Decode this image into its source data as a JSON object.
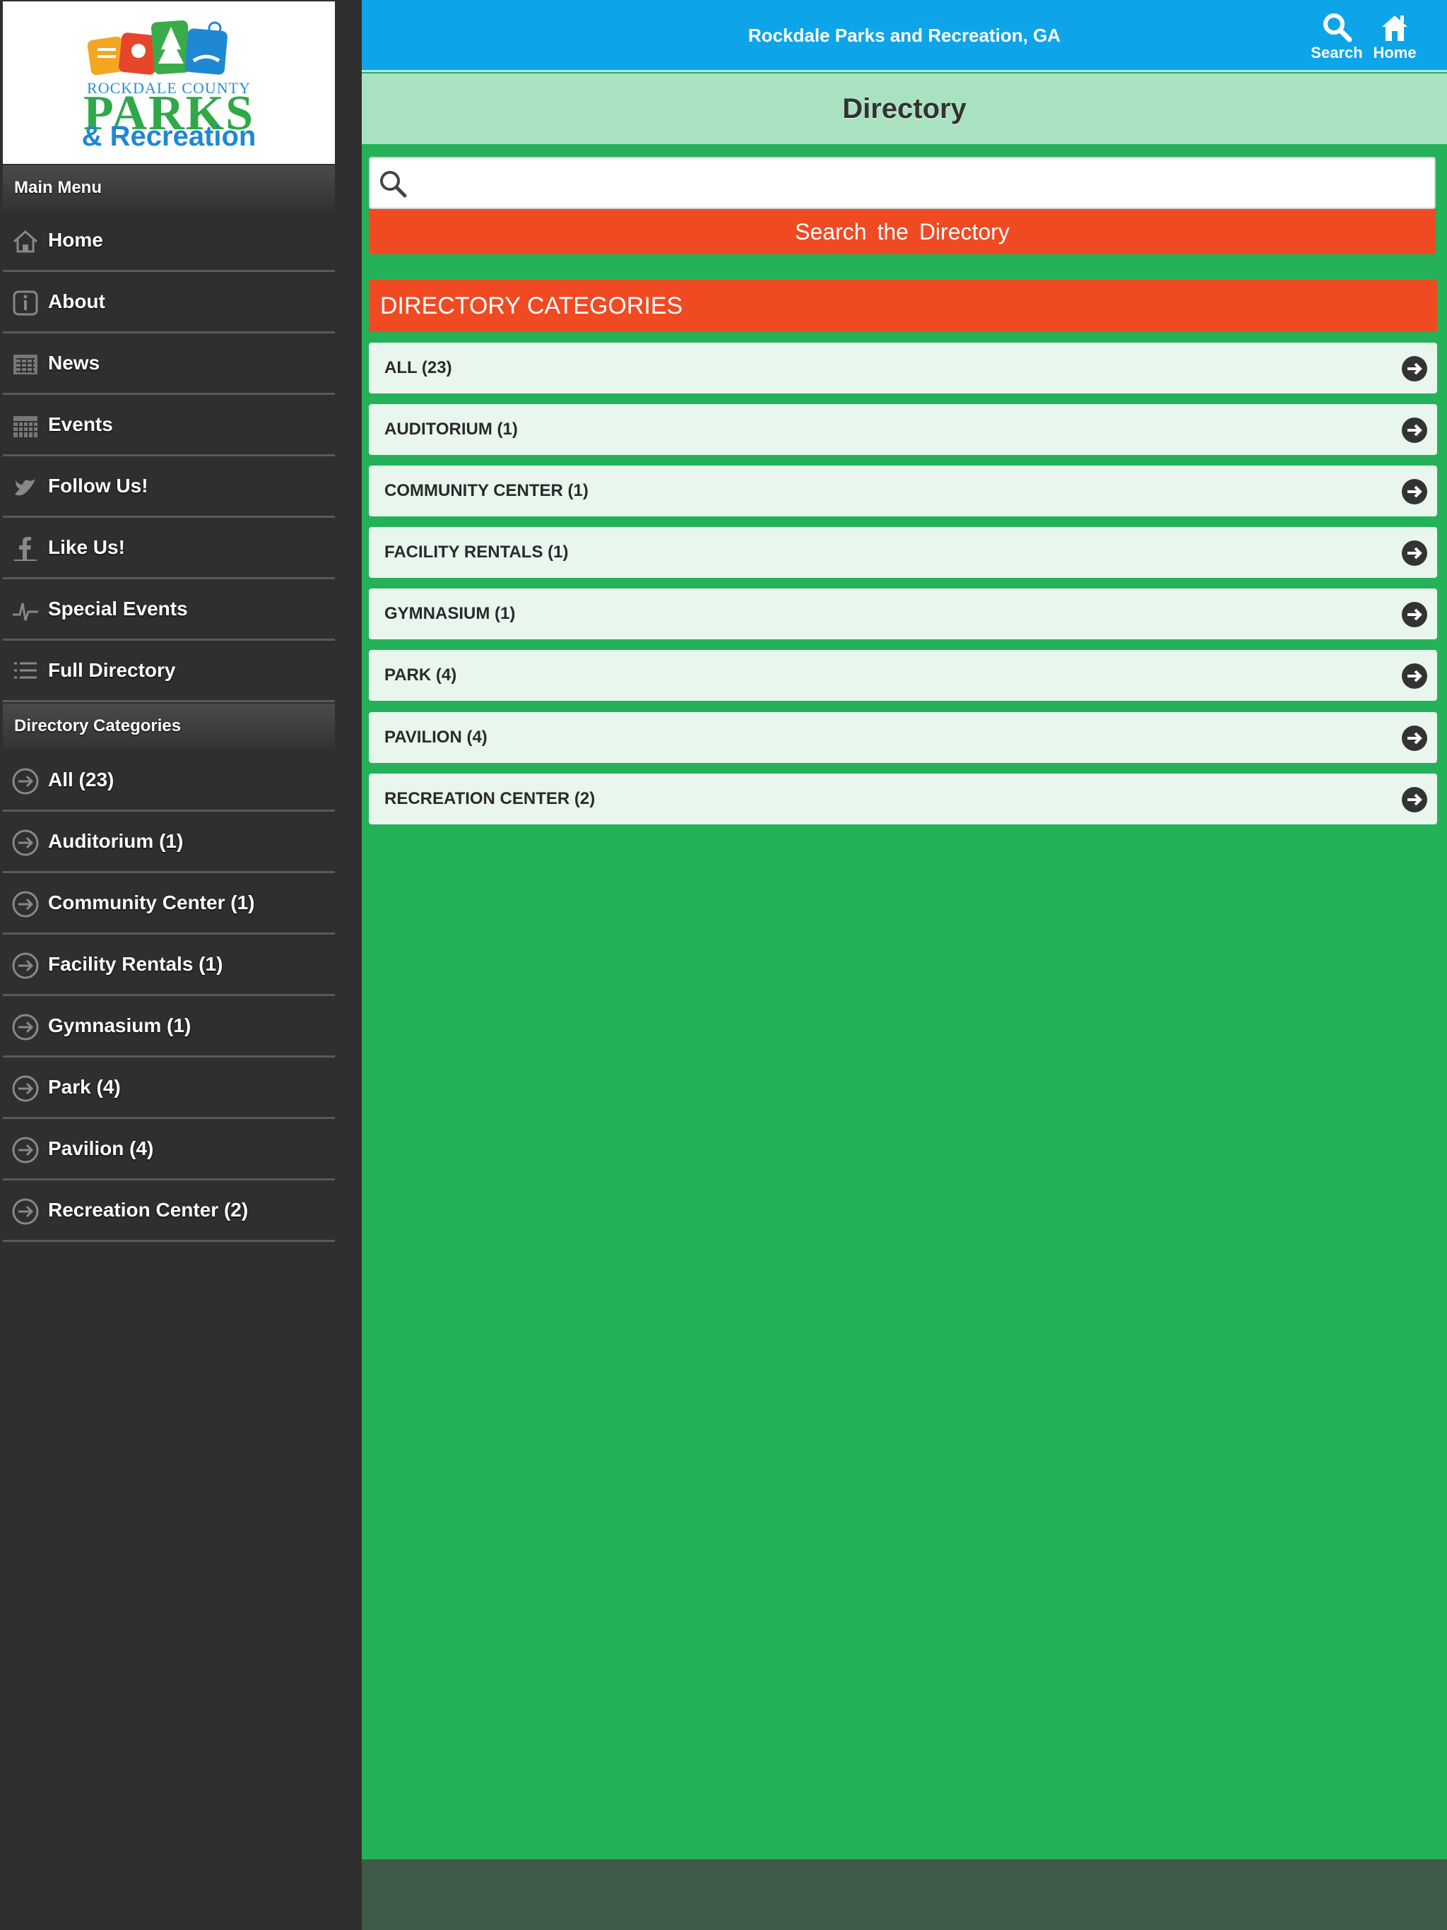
{
  "header": {
    "title": "Rockdale Parks and Recreation, GA",
    "search_label": "Search",
    "home_label": "Home"
  },
  "logo": {
    "line1": "ROCKDALE COUNTY",
    "line2": "PARKS",
    "line3": "& Recreation"
  },
  "sidebar": {
    "main_menu_heading": "Main Menu",
    "main_menu": [
      {
        "label": "Home",
        "icon": "home-icon"
      },
      {
        "label": "About",
        "icon": "info-icon"
      },
      {
        "label": "News",
        "icon": "newspaper-icon"
      },
      {
        "label": "Events",
        "icon": "calendar-icon"
      },
      {
        "label": "Follow Us!",
        "icon": "twitter-icon"
      },
      {
        "label": "Like Us!",
        "icon": "facebook-icon"
      },
      {
        "label": "Special Events",
        "icon": "pulse-icon"
      },
      {
        "label": "Full Directory",
        "icon": "list-icon"
      }
    ],
    "categories_heading": "Directory Categories",
    "categories": [
      {
        "label": "All (23)"
      },
      {
        "label": "Auditorium (1)"
      },
      {
        "label": "Community Center (1)"
      },
      {
        "label": "Facility Rentals (1)"
      },
      {
        "label": "Gymnasium (1)"
      },
      {
        "label": "Park (4)"
      },
      {
        "label": "Pavilion (4)"
      },
      {
        "label": "Recreation Center (2)"
      }
    ]
  },
  "main": {
    "page_title": "Directory",
    "search": {
      "value": "",
      "placeholder": "",
      "button_label": "Search  the Directory"
    },
    "categories_heading": "DIRECTORY CATEGORIES",
    "categories": [
      {
        "label": "ALL (23)"
      },
      {
        "label": "AUDITORIUM (1)"
      },
      {
        "label": "COMMUNITY CENTER (1)"
      },
      {
        "label": "FACILITY RENTALS (1)"
      },
      {
        "label": "GYMNASIUM (1)"
      },
      {
        "label": "PARK (4)"
      },
      {
        "label": "PAVILION (4)"
      },
      {
        "label": "RECREATION CENTER (2)"
      }
    ]
  },
  "colors": {
    "topbar": "#0ea5e8",
    "main_bg": "#25b158",
    "accent_orange": "#f04a23",
    "sidebar_bg": "#2f2f2f"
  }
}
